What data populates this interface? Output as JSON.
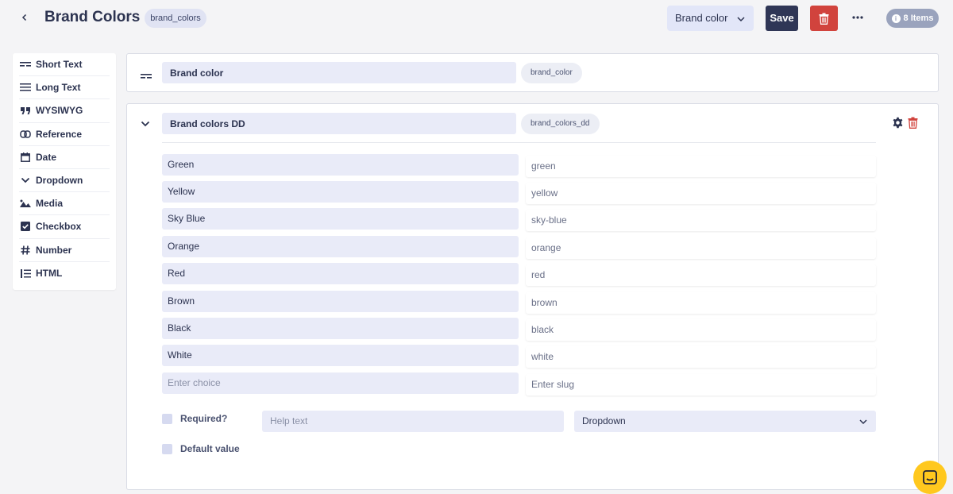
{
  "header": {
    "title": "Brand Colors",
    "slug": "brand_colors",
    "field_select": "Brand color",
    "save_label": "Save",
    "items_badge": "8 Items"
  },
  "sidebar": {
    "items": [
      {
        "label": "Short Text",
        "icon": "short-text-icon"
      },
      {
        "label": "Long Text",
        "icon": "long-text-icon"
      },
      {
        "label": "WYSIWYG",
        "icon": "quote-icon"
      },
      {
        "label": "Reference",
        "icon": "link-icon"
      },
      {
        "label": "Date",
        "icon": "calendar-icon"
      },
      {
        "label": "Dropdown",
        "icon": "chevron-down-icon"
      },
      {
        "label": "Media",
        "icon": "image-icon"
      },
      {
        "label": "Checkbox",
        "icon": "checkbox-icon"
      },
      {
        "label": "Number",
        "icon": "hash-icon"
      },
      {
        "label": "HTML",
        "icon": "list-icon"
      }
    ]
  },
  "field1": {
    "name": "Brand color",
    "slug": "brand_color"
  },
  "field2": {
    "name": "Brand colors DD",
    "slug": "brand_colors_dd",
    "choices": [
      {
        "label": "Green",
        "slug": "green"
      },
      {
        "label": "Yellow",
        "slug": "yellow"
      },
      {
        "label": "Sky Blue",
        "slug": "sky-blue"
      },
      {
        "label": "Orange",
        "slug": "orange"
      },
      {
        "label": "Red",
        "slug": "red"
      },
      {
        "label": "Brown",
        "slug": "brown"
      },
      {
        "label": "Black",
        "slug": "black"
      },
      {
        "label": "White",
        "slug": "white"
      }
    ],
    "new_choice_placeholder": "Enter choice",
    "new_slug_placeholder": "Enter slug",
    "required_label": "Required?",
    "help_placeholder": "Help text",
    "type_select": "Dropdown",
    "default_label": "Default value"
  },
  "colors": {
    "primary": "#2f3656",
    "danger": "#d1433d",
    "input_bg": "#e9ebf8",
    "badge": "#9aa3bd",
    "chat": "#ffc81e"
  }
}
